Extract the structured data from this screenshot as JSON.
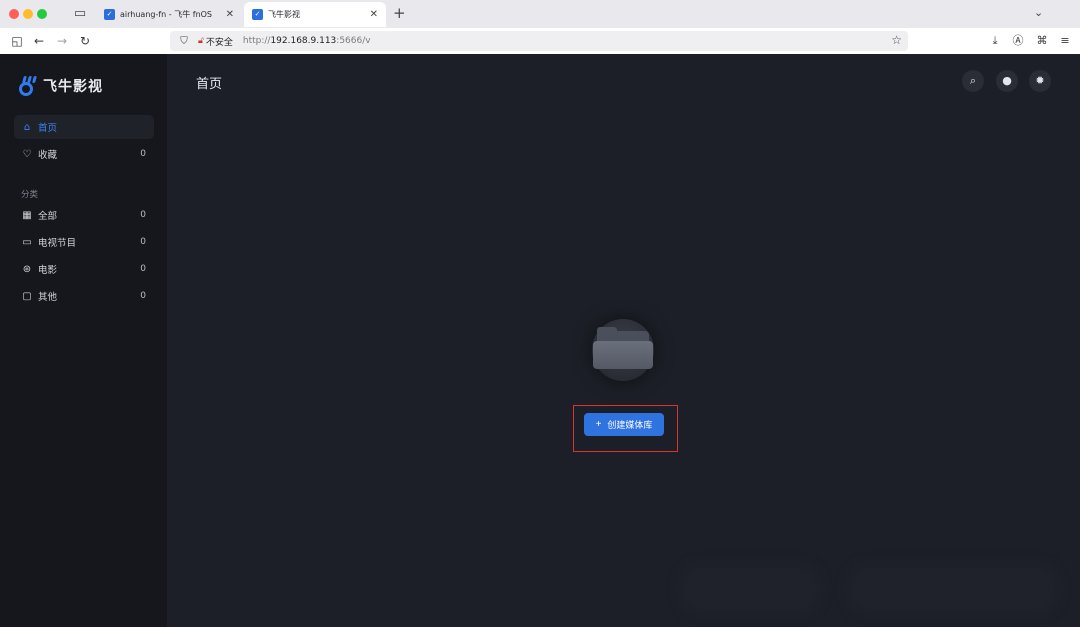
{
  "browser": {
    "tabs": [
      {
        "title": "airhuang-fn - 飞牛 fnOS",
        "active": false
      },
      {
        "title": "飞牛影视",
        "active": true
      }
    ],
    "new_tab": "+",
    "security_label": "不安全",
    "url_prefix": "http://",
    "url_host": "192.168.9.113",
    "url_rest": ":5666/v",
    "icons": [
      "tab-overview-icon",
      "sidebar-toggle-icon",
      "back-icon",
      "forward-icon",
      "reload-icon",
      "shield-icon",
      "lock-icon",
      "star-icon",
      "download-icon",
      "account-icon",
      "extensions-icon",
      "menu-icon"
    ]
  },
  "app": {
    "logo_text": "飞牛影视",
    "sidebar": {
      "items": [
        {
          "label": "首页",
          "icon": "home-icon",
          "count": "",
          "active": true
        },
        {
          "label": "收藏",
          "icon": "heart-icon",
          "count": "0",
          "active": false
        }
      ],
      "section_label": "分类",
      "categories": [
        {
          "label": "全部",
          "icon": "grid-icon",
          "count": "0"
        },
        {
          "label": "电视节目",
          "icon": "tv-icon",
          "count": "0"
        },
        {
          "label": "电影",
          "icon": "film-reel-icon",
          "count": "0"
        },
        {
          "label": "其他",
          "icon": "folder-icon",
          "count": "0"
        }
      ]
    },
    "main": {
      "title": "首页",
      "empty_icon": "folder-icon",
      "create_button": {
        "plus": "+",
        "label": "创建媒体库"
      }
    },
    "colors": {
      "accent": "#2f73e0",
      "highlight": "#d6342e",
      "sidebar_bg": "#15171c",
      "main_bg": "#1c1f27"
    }
  }
}
